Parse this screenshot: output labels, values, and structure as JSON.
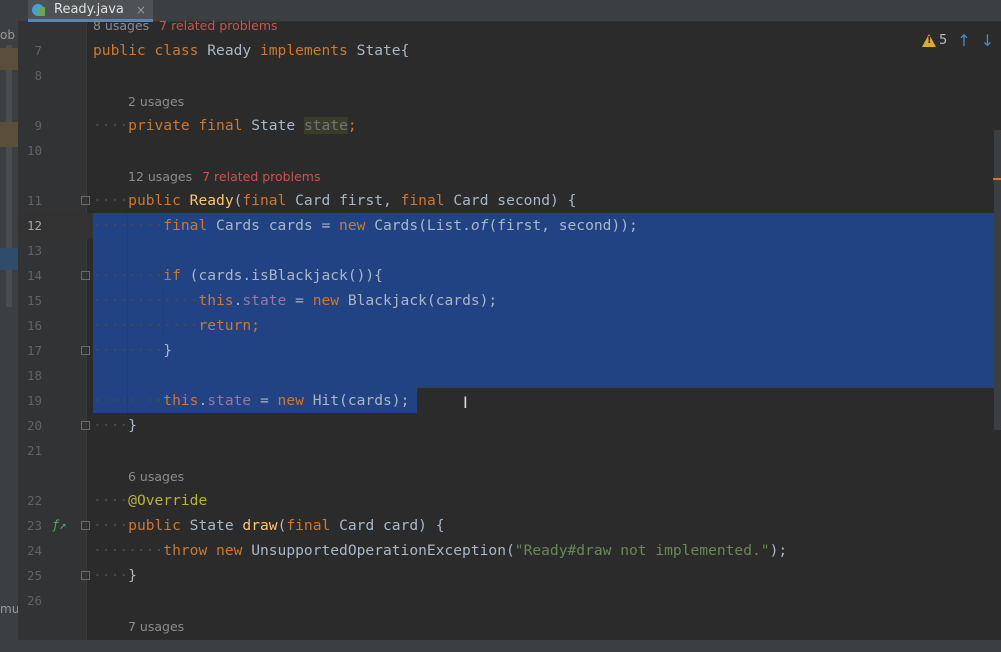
{
  "tab": {
    "label": "Ready.java",
    "close": "×"
  },
  "left_strip": {
    "text_top": "ob",
    "text_bottom": "mu"
  },
  "inspection": {
    "warning_count": "5",
    "up": "↑",
    "down": "↓"
  },
  "hints": {
    "top": {
      "usages": "8 usages",
      "problems": "7 related problems"
    },
    "state_field": {
      "usages": "2 usages"
    },
    "constructor": {
      "usages": "12 usages",
      "problems": "7 related problems"
    },
    "override": {
      "usages": "6 usages"
    },
    "bottom": {
      "usages": "7 usages"
    }
  },
  "line_numbers": [
    "7",
    "8",
    "9",
    "10",
    "11",
    "12",
    "13",
    "14",
    "15",
    "16",
    "17",
    "18",
    "19",
    "20",
    "21",
    "22",
    "23",
    "24",
    "25",
    "26"
  ],
  "code": {
    "l7": {
      "kw1": "public",
      "kw2": "class",
      "name": "Ready",
      "kw3": "implements",
      "rest": "State{"
    },
    "l9": {
      "kw1": "private",
      "kw2": "final",
      "type": "State",
      "field": "state",
      "end": ";"
    },
    "l11": {
      "kw1": "public",
      "fn": "Ready",
      "p1": "(",
      "kw2": "final",
      "t1": "Card",
      "a1": "first,",
      "kw3": "final",
      "t2": "Card",
      "a2": "second) {"
    },
    "l12": {
      "kw1": "final",
      "t": "Cards cards = ",
      "kw2": "new",
      "r1": "Cards(List.",
      "it": "of",
      "r2": "(first, second));"
    },
    "l14": {
      "kw1": "if",
      "r": "(cards.isBlackjack()){"
    },
    "l15": {
      "kw1": "this",
      "dot": ".",
      "fld": "state",
      "eq": " = ",
      "kw2": "new",
      "r": "Blackjack(cards);"
    },
    "l16": {
      "kw1": "return",
      "r": ";"
    },
    "l17": {
      "r": "}"
    },
    "l19": {
      "kw1": "this",
      "dot": ".",
      "fld": "state",
      "eq": " = ",
      "kw2": "new",
      "r": "Hit(cards);"
    },
    "l20": {
      "r": "}"
    },
    "l22": {
      "ann": "@Override"
    },
    "l23": {
      "kw1": "public",
      "t": "State",
      "fn": "draw",
      "p": "(",
      "kw2": "final",
      "r": "Card card) {"
    },
    "l24": {
      "kw1": "throw",
      "kw2": "new",
      "r1": "UnsupportedOperationException(",
      "str": "\"Ready#draw not implemented.\"",
      "r2": ");"
    },
    "l25": {
      "r": "}"
    }
  },
  "colors": {
    "selection": "#214283",
    "keyword": "#cc7832",
    "function": "#ffc66d",
    "field": "#9876aa",
    "string": "#6a8759",
    "annotation": "#bbb529"
  }
}
